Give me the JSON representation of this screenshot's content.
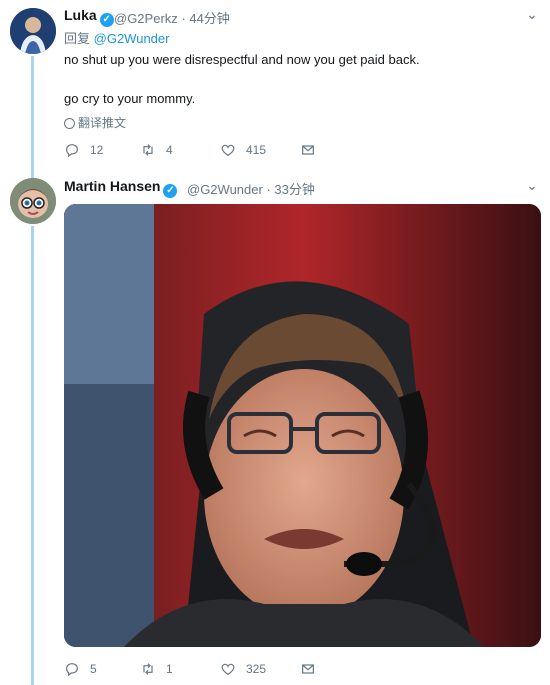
{
  "tweet1": {
    "name": "Luka",
    "handle": "@G2Perkz",
    "time": "44分钟",
    "reply_prefix": "回复",
    "reply_to": "@G2Wunder",
    "line1": "no shut up you were disrespectful and now you get paid back.",
    "line2": "go cry to your mommy.",
    "translate": "翻译推文",
    "replies": "12",
    "retweets": "4",
    "likes": "415"
  },
  "tweet2": {
    "name": "Martin Hansen",
    "handle": "@G2Wunder",
    "time": "33分钟",
    "replies": "5",
    "retweets": "1",
    "likes": "325"
  },
  "icons": {
    "verified": "verified-badge-icon",
    "chevron": "chevron-down-icon",
    "reply": "reply-icon",
    "retweet": "retweet-icon",
    "like": "heart-icon",
    "dm": "envelope-icon",
    "translate": "globe-icon"
  },
  "colors": {
    "accent": "#1da1f2",
    "thread": "#a9d3ee",
    "muted": "#657786"
  }
}
